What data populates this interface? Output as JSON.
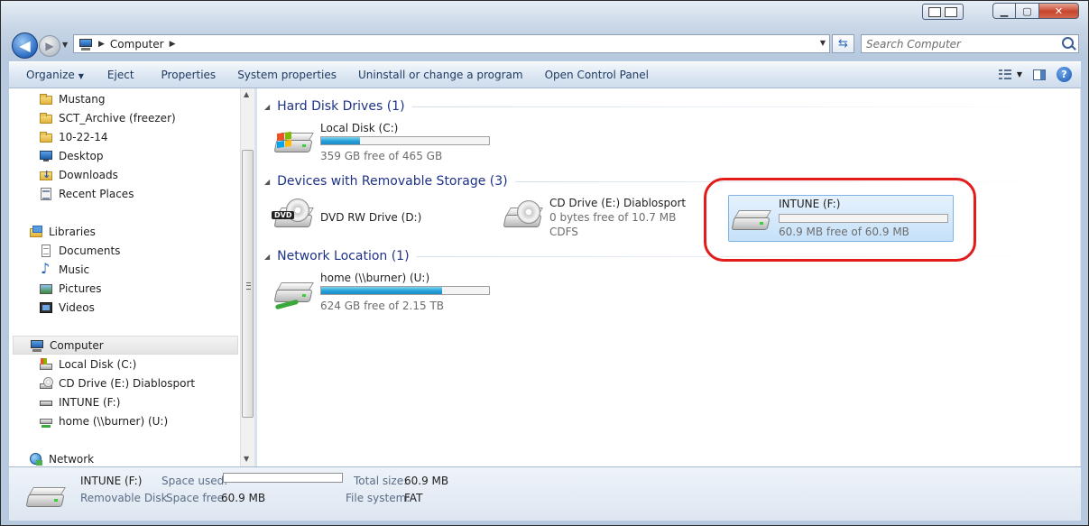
{
  "address": {
    "crumbs": [
      "Computer"
    ]
  },
  "search": {
    "placeholder": "Search Computer"
  },
  "toolbar": {
    "items": [
      {
        "label": "Organize",
        "has_dropdown": true
      },
      {
        "label": "Eject"
      },
      {
        "label": "Properties"
      },
      {
        "label": "System properties"
      },
      {
        "label": "Uninstall or change a program"
      },
      {
        "label": "Open Control Panel"
      }
    ]
  },
  "nav": {
    "favorites": [
      {
        "label": "Mustang",
        "icon": "folder-icon"
      },
      {
        "label": "SCT_Archive (freezer)",
        "icon": "folder-icon"
      },
      {
        "label": "10-22-14",
        "icon": "folder-icon"
      },
      {
        "label": "Desktop",
        "icon": "desktop-icon"
      },
      {
        "label": "Downloads",
        "icon": "downloads-icon"
      },
      {
        "label": "Recent Places",
        "icon": "recent-places-icon"
      }
    ],
    "libraries_label": "Libraries",
    "libraries": [
      {
        "label": "Documents",
        "icon": "documents-icon"
      },
      {
        "label": "Music",
        "icon": "music-icon"
      },
      {
        "label": "Pictures",
        "icon": "pictures-icon"
      },
      {
        "label": "Videos",
        "icon": "videos-icon"
      }
    ],
    "computer_label": "Computer",
    "computer": [
      {
        "label": "Local Disk (C:)",
        "icon": "hard-drive-icon"
      },
      {
        "label": "CD Drive (E:) Diablosport",
        "icon": "cd-drive-icon"
      },
      {
        "label": "INTUNE (F:)",
        "icon": "usb-drive-icon"
      },
      {
        "label": "home (\\\\burner) (U:)",
        "icon": "network-drive-icon"
      }
    ],
    "network_label": "Network"
  },
  "groups": {
    "hdd": {
      "title": "Hard Disk Drives (1)",
      "items": [
        {
          "name": "Local Disk (C:)",
          "free": "359 GB free of 465 GB",
          "used_fraction": 0.23
        }
      ]
    },
    "removable": {
      "title": "Devices with Removable Storage (3)",
      "items": [
        {
          "name": "DVD RW Drive (D:)"
        },
        {
          "name": "CD Drive (E:) Diablosport",
          "free": "0 bytes free of 10.7 MB",
          "fs": "CDFS"
        },
        {
          "name": "INTUNE (F:)",
          "free": "60.9 MB free of 60.9 MB",
          "used_fraction": 0.0
        }
      ]
    },
    "network": {
      "title": "Network Location (1)",
      "items": [
        {
          "name": "home (\\\\burner) (U:)",
          "free": "624 GB free of 2.15 TB",
          "used_fraction": 0.72
        }
      ]
    }
  },
  "details": {
    "name": "INTUNE (F:)",
    "type": "Removable Disk",
    "space_used_label": "Space used:",
    "space_used_fraction": 0.0,
    "space_free_label": "Space free:",
    "space_free": "60.9 MB",
    "total_size_label": "Total size:",
    "total_size": "60.9 MB",
    "file_system_label": "File system:",
    "file_system": "FAT"
  },
  "colors": {
    "highlight_ring": "#e21b1b",
    "bar_fill": "#26a0da",
    "group_title": "#1e3287"
  }
}
